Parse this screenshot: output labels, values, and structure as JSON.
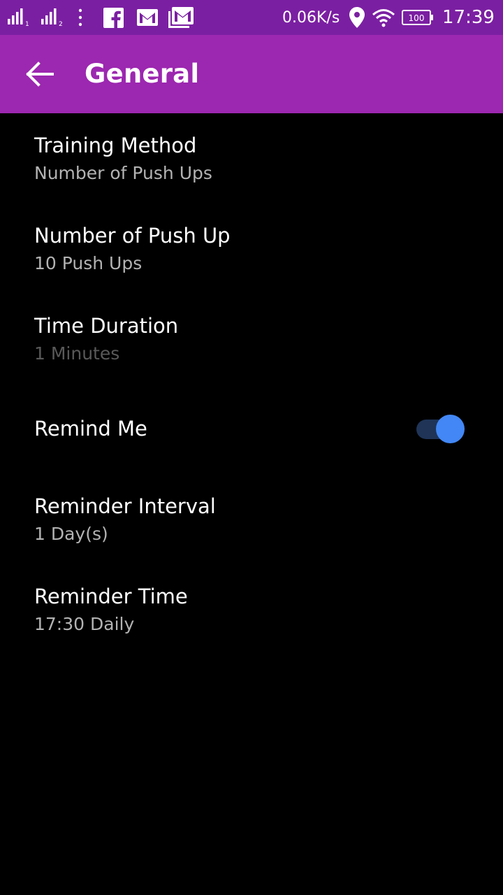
{
  "status_bar": {
    "sim1_label": "1",
    "sim2_label": "2",
    "net_speed": "0.06K/s",
    "battery": "100",
    "time": "17:39",
    "icons": [
      "signal-icon",
      "signal-icon",
      "more-vert-icon",
      "facebook-icon",
      "gmail-icon",
      "gmail-icon",
      "location-icon",
      "wifi-icon",
      "battery-icon"
    ]
  },
  "toolbar": {
    "back_icon": "arrow-back-icon",
    "title": "General"
  },
  "settings": [
    {
      "title": "Training Method",
      "summary": "Number of Push Ups",
      "enabled": true
    },
    {
      "title": "Number of Push Up",
      "summary": "10 Push Ups",
      "enabled": true
    },
    {
      "title": "Time Duration",
      "summary": "1 Minutes",
      "enabled": false
    },
    {
      "title": "Remind Me",
      "switch_on": true
    },
    {
      "title": "Reminder Interval",
      "summary": "1 Day(s)",
      "enabled": true
    },
    {
      "title": "Reminder Time",
      "summary": "17:30 Daily",
      "enabled": true
    }
  ],
  "colors": {
    "status_bar": "#7b1fa2",
    "toolbar": "#9c27b0",
    "background": "#000000",
    "switch_thumb": "#4287f5",
    "switch_track": "#1f3457"
  }
}
